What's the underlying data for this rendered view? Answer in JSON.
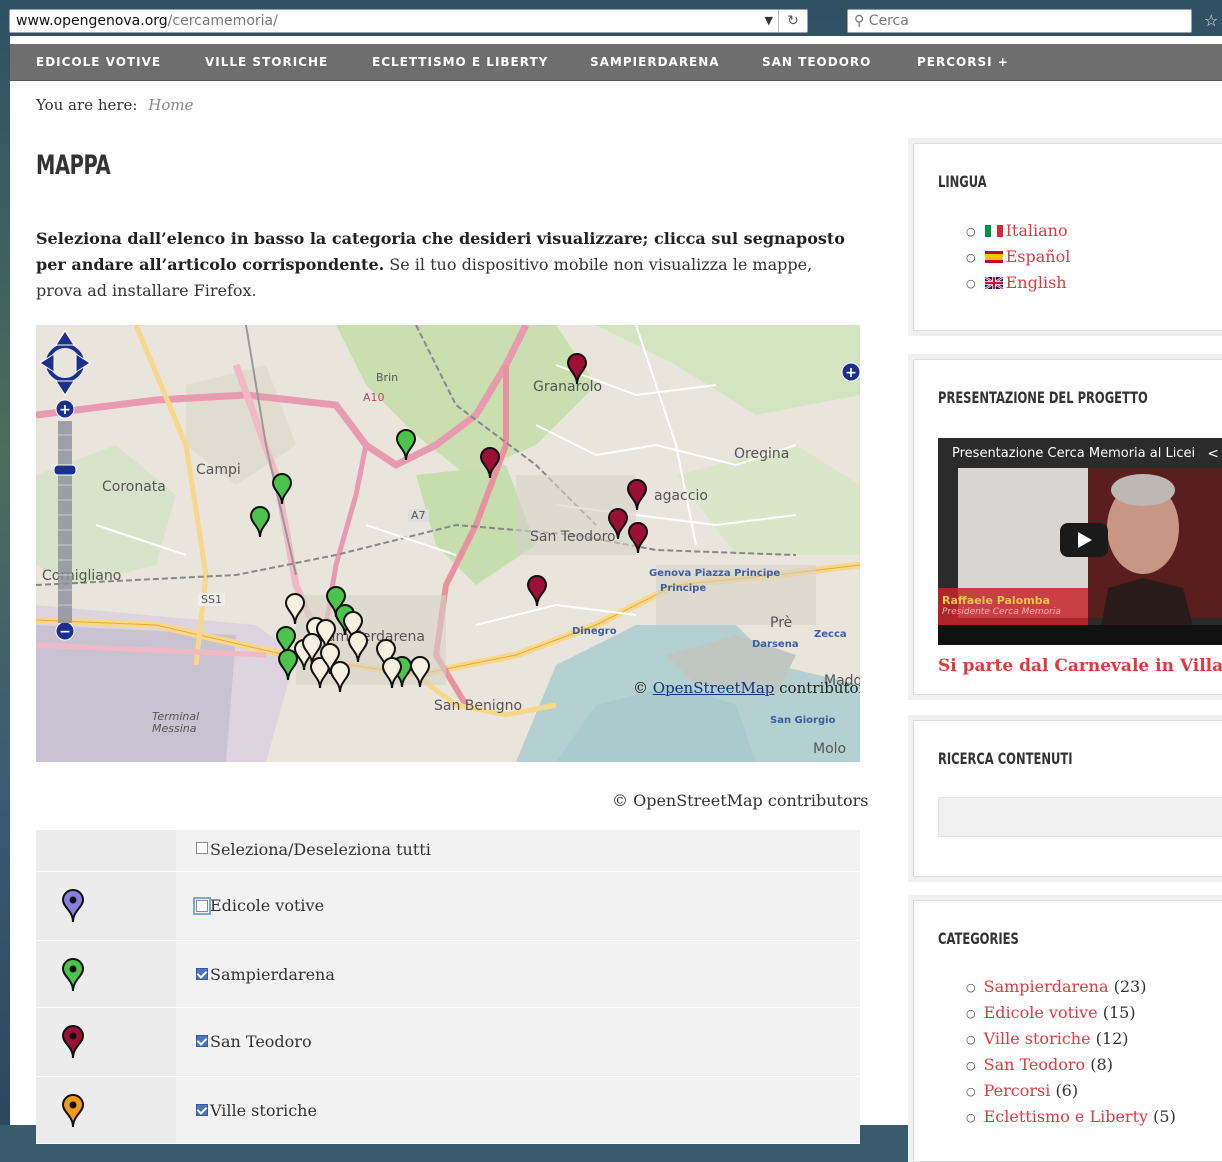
{
  "browser": {
    "url_host": "www.opengenova.org",
    "url_path": "/cercamemoria/",
    "search_placeholder": "Cerca"
  },
  "nav": {
    "items": [
      "EDICOLE VOTIVE",
      "VILLE STORICHE",
      "ECLETTISMO E LIBERTY",
      "SAMPIERDARENA",
      "SAN TEODORO",
      "PERCORSI  +"
    ]
  },
  "breadcrumb": {
    "label": "You are here:",
    "current": "Home"
  },
  "page_title": "MAPPA",
  "intro": {
    "bold": "Seleziona dall’elenco in basso la categoria che desideri visualizzare; clicca sul segnaposto per andare all’articolo corrispondente.",
    "rest": " Se il tuo dispositivo mobile non visualizza le mappe, prova ad installare Firefox."
  },
  "map": {
    "labels": {
      "granarolo": "Granarolo",
      "oregina": "Oregina",
      "campi": "Campi",
      "coronata": "Coronata",
      "cornigliano": "Cornigliano",
      "san_teodoro": "San Teodoro",
      "lagaccio": "agaccio",
      "sampierdarena": "Sampierdarena",
      "san_benigno": "San Benigno",
      "terminal": "Terminal",
      "messina": "Messina",
      "brin": "Brin",
      "dinegro": "Dinegro",
      "principe": "Genova Piazza Principe",
      "principe2": "Principe",
      "pre": "Prè",
      "darsena": "Darsena",
      "zecca": "Zecca",
      "molo": "Molo",
      "maddal": "Maddal",
      "san_giorgio": "San Giorgio",
      "a10": "A10",
      "a7": "A7",
      "ss1": "SS1"
    },
    "credit_link": "OpenStreetMap",
    "credit_rest": " contributors",
    "credit_prefix": "© "
  },
  "credit": "© OpenStreetMap contributors",
  "legend": {
    "select_all": "Seleziona/Deseleziona tutti",
    "rows": [
      {
        "label": "Edicole votive",
        "color": "#8a7fe0",
        "checked": false
      },
      {
        "label": "Sampierdarena",
        "color": "#4cc34c",
        "checked": true
      },
      {
        "label": "San Teodoro",
        "color": "#9c1036",
        "checked": true
      },
      {
        "label": "Ville storiche",
        "color": "#f39a1c",
        "checked": true
      }
    ]
  },
  "sidebar": {
    "lingua": {
      "title": "LINGUA",
      "items": [
        "Italiano",
        "Español",
        "English"
      ]
    },
    "presentazione": {
      "title": "PRESENTAZIONE DEL PROGETTO",
      "video_title": "Presentazione Cerca Memoria al Licei",
      "video_name": "Raffaele Palomba",
      "video_sub": "Presidente Cerca Memoria",
      "link": "Si parte dal Carnevale in Villa"
    },
    "ricerca": {
      "title": "RICERCA CONTENUTI"
    },
    "categories": {
      "title": "CATEGORIES",
      "items": [
        {
          "name": "Sampierdarena",
          "count": "(23)"
        },
        {
          "name": "Edicole votive",
          "count": "(15)"
        },
        {
          "name": "Ville storiche",
          "count": "(12)"
        },
        {
          "name": "San Teodoro",
          "count": "(8)"
        },
        {
          "name": "Percorsi",
          "count": "(6)"
        },
        {
          "name": "Eclettismo e Liberty",
          "count": "(5)"
        }
      ]
    }
  }
}
